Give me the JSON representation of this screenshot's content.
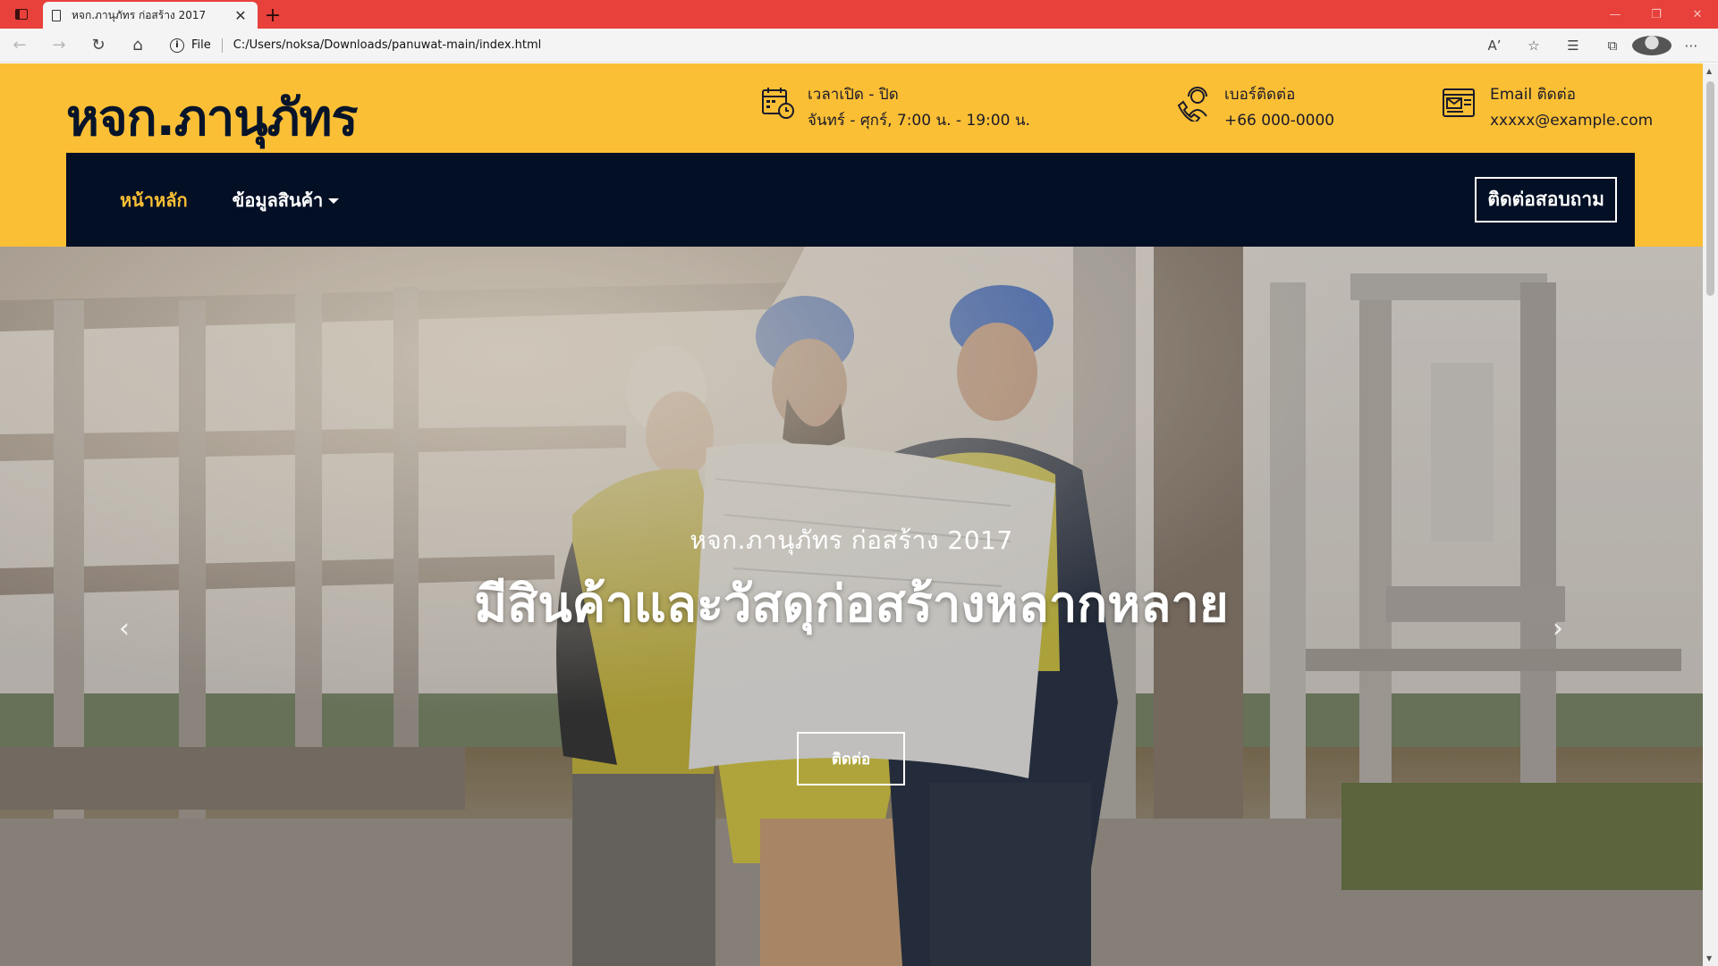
{
  "browser": {
    "tab_title": "หจก.ภานุภัทร ก่อสร้าง 2017",
    "tab_close": "✕",
    "new_tab": "+",
    "url_scheme": "File",
    "url_path": "C:/Users/noksa/Downloads/panuwat-main/index.html"
  },
  "header": {
    "brand": "หจก.ภานุภัทร",
    "hours": {
      "label": "เวลาเปิด - ปิด",
      "value": "จันทร์ - ศุกร์, 7:00 น. - 19:00 น."
    },
    "phone": {
      "label": "เบอร์ติดต่อ",
      "value": "+66 000-0000"
    },
    "email": {
      "label": "Email ติดต่อ",
      "value": "xxxxx@example.com"
    }
  },
  "nav": {
    "items": [
      {
        "label": "หน้าหลัก"
      },
      {
        "label": "ข้อมูลสินค้า"
      }
    ],
    "contact_button": "ติดต่อสอบถาม"
  },
  "hero": {
    "subtitle": "หจก.ภานุภัทร ก่อสร้าง 2017",
    "title": "มีสินค้าและวัสดุก่อสร้างหลากหลาย",
    "button": "ติดต่อ",
    "prev_icon": "chevron-left-icon",
    "next_icon": "chevron-right-icon"
  },
  "colors": {
    "accent": "#fbbf35",
    "navbar": "#020f25",
    "titlebar": "#e8403a"
  }
}
